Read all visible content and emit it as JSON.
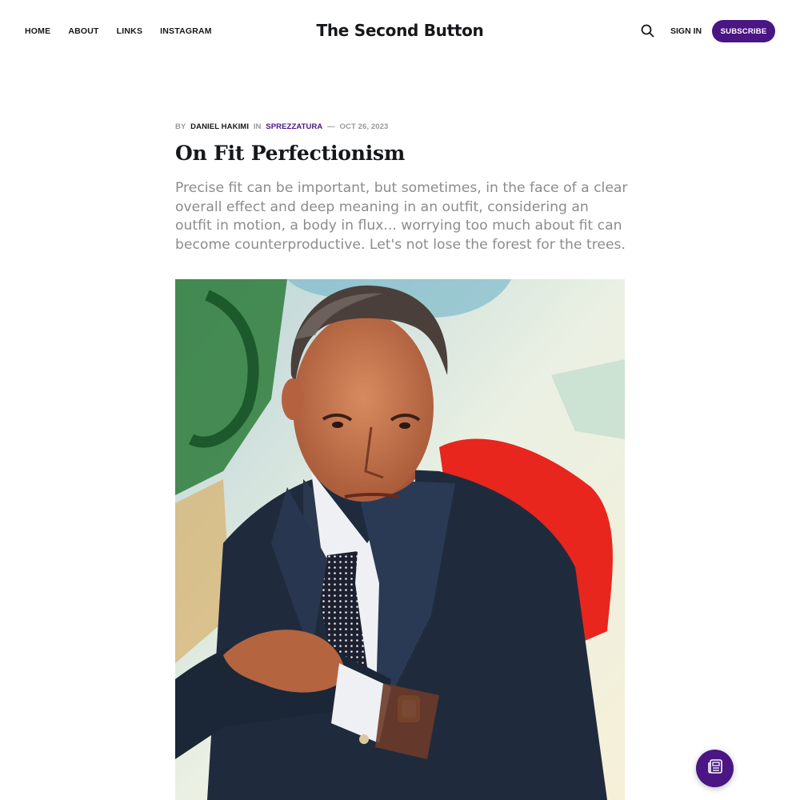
{
  "header": {
    "nav": [
      {
        "label": "HOME"
      },
      {
        "label": "ABOUT"
      },
      {
        "label": "LINKS"
      },
      {
        "label": "INSTAGRAM"
      }
    ],
    "site_title": "The Second Button",
    "search_icon": "search-icon",
    "sign_in_label": "SIGN IN",
    "subscribe_label": "SUBSCRIBE"
  },
  "post": {
    "meta": {
      "by_label": "BY",
      "author": "DANIEL HAKIMI",
      "in_label": "IN",
      "tag": "SPREZZATURA",
      "separator": "—",
      "date": "OCT 26, 2023"
    },
    "title": "On Fit Perfectionism",
    "excerpt": "Precise fit can be important, but sometimes, in the face of a clear overall effect and deep meaning in an outfit, considering an outfit in motion, a body in flux... worrying too much about fit can become counterproductive. Let's not lose the forest for the trees.",
    "feature_image": "portrait-photo"
  },
  "fab": {
    "icon": "newspaper-icon"
  },
  "colors": {
    "accent": "#4b1584",
    "text": "#15171a",
    "muted": "#8c8c8c"
  }
}
